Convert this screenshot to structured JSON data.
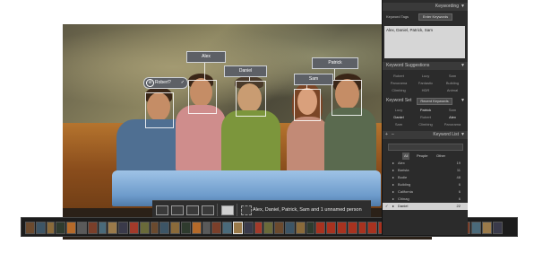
{
  "photo": {
    "face_tags": [
      {
        "name": "Alex"
      },
      {
        "name": "Daniel"
      },
      {
        "name": "Sam"
      },
      {
        "name": "Patrick"
      }
    ],
    "unconfirmed_tag": {
      "name": "Robert?",
      "check": "✓",
      "close": "⊘"
    }
  },
  "toolbar": {
    "status_text": "Alex, Daniel, Patrick, Sam and 1 unnamed person"
  },
  "panel": {
    "title": "Keywording",
    "keyword_tags": {
      "label": "Keyword Tags",
      "mode": "Enter Keywords",
      "text": "Alex, Daniel, Patrick, Sam"
    },
    "suggestions": {
      "title": "Keyword Suggestions",
      "items": [
        "Robert",
        "Lucy",
        "Sam",
        "Panorama",
        "Fantastic",
        "Building",
        "Climbing",
        "HDR",
        "Animal"
      ]
    },
    "keyword_set": {
      "label": "Keyword Set",
      "mode": "Recent Keywords",
      "items": [
        "Lucy",
        "Patrick",
        "Sam",
        "Daniel",
        "Robert",
        "Alex",
        "Sam",
        "Climbing",
        "Panorama"
      ]
    },
    "keyword_list": {
      "title": "Keyword List",
      "filters": [
        "All",
        "People",
        "Other"
      ],
      "items": [
        {
          "name": "Alex",
          "count": "19",
          "selected": false
        },
        {
          "name": "Barista",
          "count": "11",
          "selected": false
        },
        {
          "name": "Bodie",
          "count": "48",
          "selected": false
        },
        {
          "name": "Building",
          "count": "6",
          "selected": false
        },
        {
          "name": "California",
          "count": "6",
          "selected": false
        },
        {
          "name": "Chinag",
          "count": "6",
          "selected": false
        },
        {
          "name": "Daniel",
          "count": "22",
          "selected": true
        }
      ]
    },
    "icons": [
      "triangle-down-icon",
      "plus-icon",
      "minus-icon",
      "check-icon"
    ]
  },
  "colors": {
    "panel_bg": "#2b2b2b",
    "panel_header": "#3a3a3a",
    "filmstrip_bg": "#1c1c1c",
    "tag_bg": "#5d6066"
  }
}
